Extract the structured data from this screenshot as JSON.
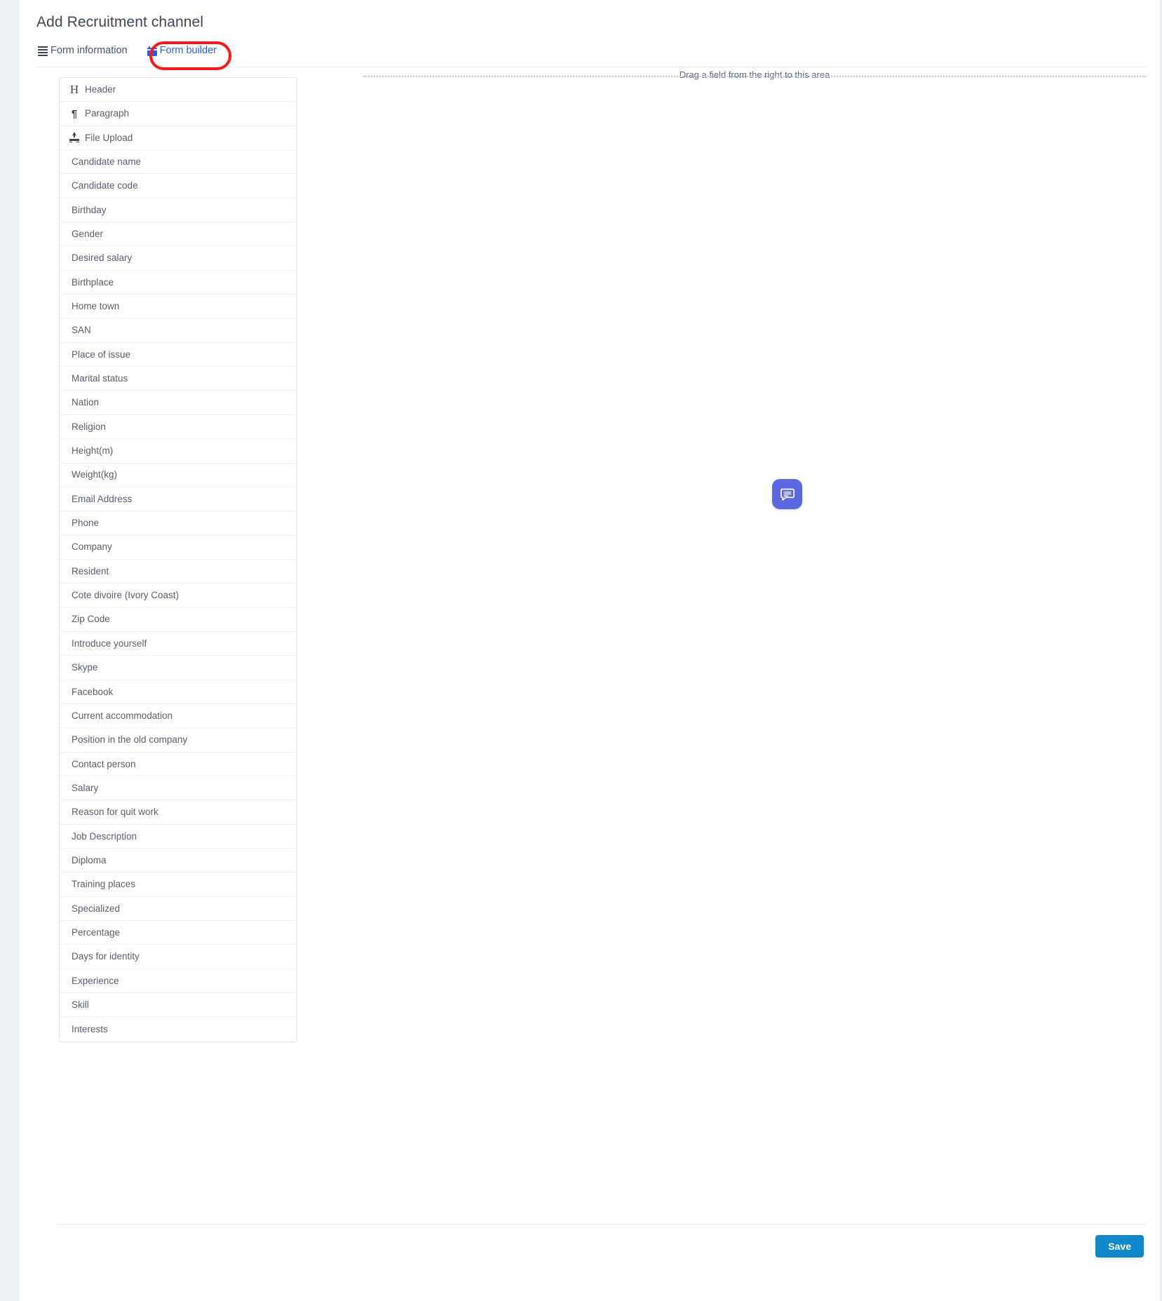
{
  "page": {
    "title": "Add Recruitment channel"
  },
  "tabs": [
    {
      "label": "Form information",
      "icon": "bars-icon",
      "active": false
    },
    {
      "label": "Form builder",
      "icon": "calendar-icon",
      "active": true
    }
  ],
  "annotation": {
    "type": "highlight-ellipse",
    "target": "Form builder",
    "color": "#f61b1b"
  },
  "palette": {
    "items": [
      {
        "label": "Header",
        "icon": "heading-icon"
      },
      {
        "label": "Paragraph",
        "icon": "paragraph-icon"
      },
      {
        "label": "File Upload",
        "icon": "upload-icon"
      },
      {
        "label": "Candidate name",
        "icon": null
      },
      {
        "label": "Candidate code",
        "icon": null
      },
      {
        "label": "Birthday",
        "icon": null
      },
      {
        "label": "Gender",
        "icon": null
      },
      {
        "label": "Desired salary",
        "icon": null
      },
      {
        "label": "Birthplace",
        "icon": null
      },
      {
        "label": "Home town",
        "icon": null
      },
      {
        "label": "SAN",
        "icon": null
      },
      {
        "label": "Place of issue",
        "icon": null
      },
      {
        "label": "Marital status",
        "icon": null
      },
      {
        "label": "Nation",
        "icon": null
      },
      {
        "label": "Religion",
        "icon": null
      },
      {
        "label": "Height(m)",
        "icon": null
      },
      {
        "label": "Weight(kg)",
        "icon": null
      },
      {
        "label": "Email Address",
        "icon": null
      },
      {
        "label": "Phone",
        "icon": null
      },
      {
        "label": "Company",
        "icon": null
      },
      {
        "label": "Resident",
        "icon": null
      },
      {
        "label": "Cote divoire (Ivory Coast)",
        "icon": null
      },
      {
        "label": "Zip Code",
        "icon": null
      },
      {
        "label": "Introduce yourself",
        "icon": null
      },
      {
        "label": "Skype",
        "icon": null
      },
      {
        "label": "Facebook",
        "icon": null
      },
      {
        "label": "Current accommodation",
        "icon": null
      },
      {
        "label": "Position in the old company",
        "icon": null
      },
      {
        "label": "Contact person",
        "icon": null
      },
      {
        "label": "Salary",
        "icon": null
      },
      {
        "label": "Reason for quit work",
        "icon": null
      },
      {
        "label": "Job Description",
        "icon": null
      },
      {
        "label": "Diploma",
        "icon": null
      },
      {
        "label": "Training places",
        "icon": null
      },
      {
        "label": "Specialized",
        "icon": null
      },
      {
        "label": "Percentage",
        "icon": null
      },
      {
        "label": "Days for identity",
        "icon": null
      },
      {
        "label": "Experience",
        "icon": null
      },
      {
        "label": "Skill",
        "icon": null
      },
      {
        "label": "Interests",
        "icon": null
      }
    ]
  },
  "dropzone": {
    "hint": "Drag a field from the right to this area"
  },
  "chat_widget": {
    "icon": "chat-bubble-icon",
    "color": "#5b68e0"
  },
  "footer": {
    "save_label": "Save",
    "save_color": "#1087c9"
  },
  "icon_glyphs": {
    "heading": "H",
    "paragraph": "¶"
  }
}
